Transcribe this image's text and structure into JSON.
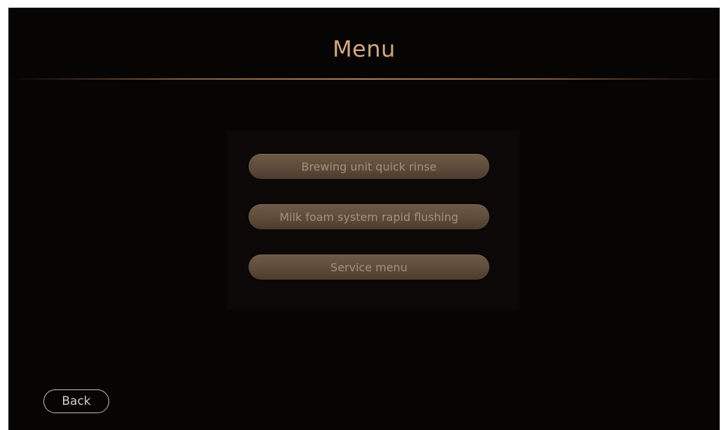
{
  "header": {
    "title": "Menu"
  },
  "menu": {
    "items": [
      {
        "label": "Brewing unit quick rinse"
      },
      {
        "label": "Milk foam system rapid flushing"
      },
      {
        "label": "Service menu"
      }
    ]
  },
  "footer": {
    "back_label": "Back"
  },
  "colors": {
    "background": "#070404",
    "title": "#d1a883",
    "button_fill": "#5e4b3a",
    "button_text": "#a6907c",
    "back_outline": "#c9c0b8"
  }
}
